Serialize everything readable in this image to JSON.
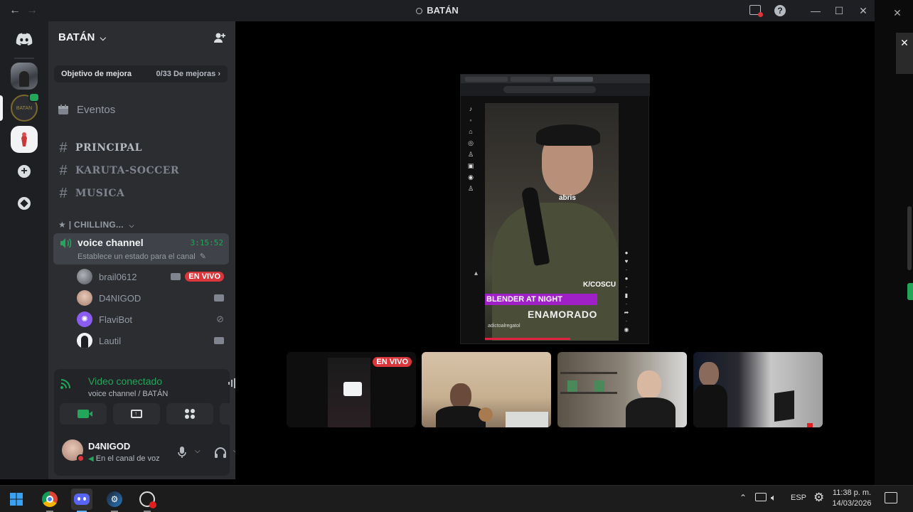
{
  "window": {
    "title": "BATÁN",
    "back_icon": "arrow-left-icon",
    "forward_icon": "arrow-right-icon",
    "controls": [
      "minimize-icon",
      "maximize-icon",
      "close-icon"
    ]
  },
  "server": {
    "name": "BATÁN",
    "boost": {
      "label": "Objetivo de mejora",
      "progress_text": "0/33 De mejoras",
      "progress": 0
    }
  },
  "sidebar": {
    "events_label": "Eventos",
    "channels": [
      "PRINCIPAL",
      "KARUTA-SOCCER",
      "MUSICA"
    ],
    "category": "★ | CHILLING...",
    "voice_channel": {
      "name": "voice channel",
      "timer": "3:15:52",
      "status_placeholder": "Establece un estado para el canal"
    },
    "voice_users": [
      {
        "name": "brail0612",
        "live": "EN VIVO"
      },
      {
        "name": "D4NIGOD",
        "live": ""
      },
      {
        "name": "FlaviBot",
        "live": ""
      },
      {
        "name": "Lautil",
        "live": ""
      }
    ]
  },
  "voice_panel": {
    "status": "Video conectado",
    "location": "voice channel / BATÁN"
  },
  "user_panel": {
    "username": "D4NIGOD",
    "status": "En el canal de voz"
  },
  "stream": {
    "caption_top": "abris",
    "banner": "BLENDER AT NIGHT",
    "overlay_title": "ENAMORADO",
    "watermark": "K/COSCU",
    "uploader": "adictoalregatol"
  },
  "tiles": [
    {
      "name": "stream-preview",
      "badge": "EN VIVO"
    },
    {
      "name": "camera-1",
      "badge": ""
    },
    {
      "name": "camera-2",
      "badge": ""
    },
    {
      "name": "camera-3",
      "badge": ""
    }
  ],
  "taskbar": {
    "language": "ESP",
    "time": "11:38 p. m.",
    "date": "14/03/2026"
  },
  "colors": {
    "green": "#23a55a",
    "red": "#da373c",
    "blurple": "#5865f2",
    "sidebar_bg": "#2b2d31",
    "rail_bg": "#1e1f22"
  }
}
